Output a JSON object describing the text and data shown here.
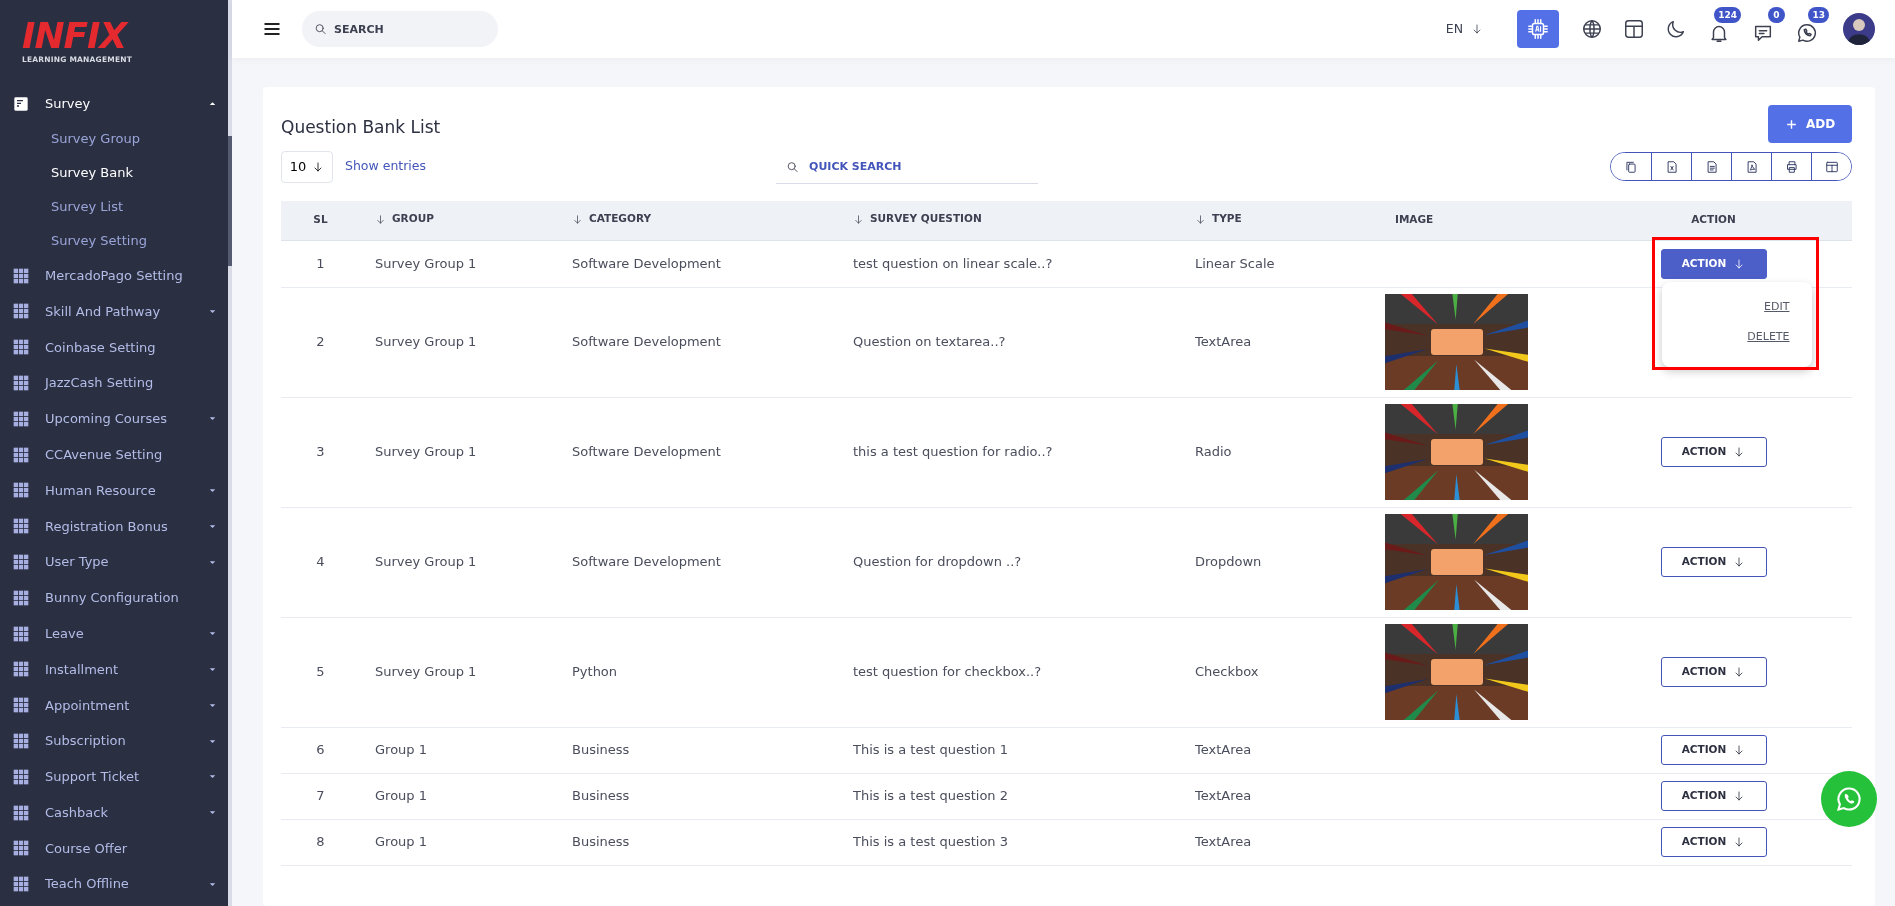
{
  "sidebar": {
    "logo": {
      "brand": "INFIX",
      "tagline": "LEARNING MANAGEMENT"
    },
    "items": [
      {
        "label": "Survey",
        "kind": "menu",
        "expanded": true,
        "children": [
          {
            "label": "Survey Group",
            "selected": false
          },
          {
            "label": "Survey Bank",
            "selected": true
          },
          {
            "label": "Survey List",
            "selected": false
          },
          {
            "label": "Survey Setting",
            "selected": false
          }
        ]
      },
      {
        "label": "MercadoPago Setting",
        "kind": "link"
      },
      {
        "label": "Skill And Pathway",
        "kind": "menu",
        "expanded": false
      },
      {
        "label": "Coinbase Setting",
        "kind": "link"
      },
      {
        "label": "JazzCash Setting",
        "kind": "link"
      },
      {
        "label": "Upcoming Courses",
        "kind": "menu",
        "expanded": false
      },
      {
        "label": "CCAvenue Setting",
        "kind": "link"
      },
      {
        "label": "Human Resource",
        "kind": "menu",
        "expanded": false
      },
      {
        "label": "Registration Bonus",
        "kind": "menu",
        "expanded": false
      },
      {
        "label": "User Type",
        "kind": "menu",
        "expanded": false
      },
      {
        "label": "Bunny Configuration",
        "kind": "link"
      },
      {
        "label": "Leave",
        "kind": "menu",
        "expanded": false
      },
      {
        "label": "Installment",
        "kind": "menu",
        "expanded": false
      },
      {
        "label": "Appointment",
        "kind": "menu",
        "expanded": false
      },
      {
        "label": "Subscription",
        "kind": "menu",
        "expanded": false
      },
      {
        "label": "Support Ticket",
        "kind": "menu",
        "expanded": false
      },
      {
        "label": "Cashback",
        "kind": "menu",
        "expanded": false
      },
      {
        "label": "Course Offer",
        "kind": "link"
      },
      {
        "label": "Teach Offline",
        "kind": "menu",
        "expanded": false
      }
    ]
  },
  "header": {
    "search": {
      "placeholder": "SEARCH"
    },
    "language": "EN",
    "icons": [
      {
        "kind": "ai",
        "selected": true
      },
      {
        "kind": "globe",
        "selected": false
      },
      {
        "kind": "layout",
        "selected": false
      },
      {
        "kind": "moon",
        "selected": false
      },
      {
        "kind": "bell",
        "selected": false,
        "badge": "124"
      },
      {
        "kind": "chat",
        "selected": false,
        "badge": "0"
      },
      {
        "kind": "whatsapp",
        "selected": false,
        "badge": "13"
      }
    ]
  },
  "card": {
    "title": "Question Bank List",
    "add_button": "ADD",
    "entries": "10",
    "entries_label": "Show entries",
    "quick_search": {
      "placeholder": "QUICK SEARCH"
    },
    "export_buttons": [
      {
        "kind": "copy"
      },
      {
        "kind": "excel"
      },
      {
        "kind": "csv"
      },
      {
        "kind": "pdf"
      },
      {
        "kind": "print"
      },
      {
        "kind": "columns"
      }
    ]
  },
  "table": {
    "columns": [
      {
        "label": "SL",
        "sortable": false
      },
      {
        "label": "GROUP",
        "sortable": true
      },
      {
        "label": "CATEGORY",
        "sortable": true
      },
      {
        "label": "SURVEY QUESTION",
        "sortable": true
      },
      {
        "label": "TYPE",
        "sortable": true
      },
      {
        "label": "IMAGE",
        "sortable": false
      },
      {
        "label": "ACTION",
        "sortable": false
      }
    ],
    "rows": [
      {
        "sl": "1",
        "group": "Survey Group 1",
        "category": "Software Development",
        "question": "test question on linear scale..?",
        "type": "Linear Scale",
        "image": false,
        "action": "ACTION",
        "open": true,
        "highlighted": true,
        "menu": [
          "EDIT",
          "DELETE"
        ]
      },
      {
        "sl": "2",
        "group": "Survey Group 1",
        "category": "Software Development",
        "question": "Question on textarea..?",
        "type": "TextArea",
        "image": true
      },
      {
        "sl": "3",
        "group": "Survey Group 1",
        "category": "Software Development",
        "question": "this a test question for radio..?",
        "type": "Radio",
        "image": true,
        "action": "ACTION",
        "open": false
      },
      {
        "sl": "4",
        "group": "Survey Group 1",
        "category": "Software Development",
        "question": "Question for dropdown ..?",
        "type": "Dropdown",
        "image": true,
        "action": "ACTION",
        "open": false
      },
      {
        "sl": "5",
        "group": "Survey Group 1",
        "category": "Python",
        "question": "test question for checkbox..?",
        "type": "Checkbox",
        "image": true,
        "action": "ACTION",
        "open": false
      },
      {
        "sl": "6",
        "group": "Group 1",
        "category": "Business",
        "question": "This is a test question 1",
        "type": "TextArea",
        "image": false,
        "action": "ACTION",
        "open": false
      },
      {
        "sl": "7",
        "group": "Group 1",
        "category": "Business",
        "question": "This is a test question 2",
        "type": "TextArea",
        "image": false,
        "action": "ACTION",
        "open": false
      },
      {
        "sl": "8",
        "group": "Group 1",
        "category": "Business",
        "question": "This is a test question 3",
        "type": "TextArea",
        "image": false,
        "action": "ACTION",
        "open": false
      }
    ]
  },
  "floating_button": {
    "kind": "whatsapp"
  }
}
